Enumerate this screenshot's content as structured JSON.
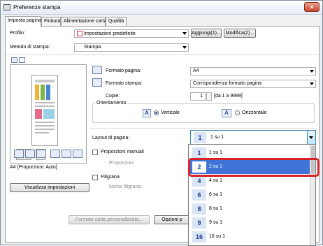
{
  "window": {
    "title": "Preferenze stampa",
    "close_label": "×"
  },
  "tabs": [
    "Imposta pagina",
    "Finitura",
    "Alimentazione carta",
    "Qualità"
  ],
  "profile": {
    "label": "Profilo:",
    "value": "Impostazioni predefinite",
    "add_btn": "Aggiungi(1)...",
    "edit_btn": "Modifica(2)..."
  },
  "print_method": {
    "label": "Metodo di stampa:",
    "value": "Stampa"
  },
  "preview": {
    "caption": "A4 [Proporzioni: Auto]",
    "view_settings_btn": "Visualizza impostazioni"
  },
  "page_settings": {
    "page_size_label": "Formato pagina:",
    "page_size_value": "A4",
    "output_size_label": "Formato stampa:",
    "output_size_value": "Corrispondenza formato pagina",
    "copies_label": "Copie:",
    "copies_value": "1",
    "copies_range": "[da 1 a 9999]"
  },
  "orientation": {
    "group_label": "Orientamento",
    "portrait": "Verticale",
    "landscape": "Orizzontale",
    "portrait_icon": "A",
    "landscape_icon": "A"
  },
  "layout": {
    "label": "Layout di pagina:",
    "value_num": "1",
    "value_text": "1 su 1"
  },
  "manual_scaling": {
    "label": "Proporzioni manuali",
    "scaling_label": "Proporzioni"
  },
  "watermark": {
    "label": "Filigrana",
    "name_label": "Nome filigrana:"
  },
  "bottom": {
    "custom_paper_btn": "Formato carta personalizzato...",
    "options_btn": "Opzioni p"
  },
  "layout_options": [
    {
      "num": "1",
      "text": "1 su 1"
    },
    {
      "num": "2",
      "text": "2 su 1"
    },
    {
      "num": "4",
      "text": "4 su 1"
    },
    {
      "num": "6",
      "text": "6 su 1"
    },
    {
      "num": "8",
      "text": "8 su 1"
    },
    {
      "num": "9",
      "text": "9 su 1"
    },
    {
      "num": "16",
      "text": "16 su 1"
    }
  ],
  "selected_layout_index": 1,
  "colors": {
    "selection": "#3f74d6",
    "highlight": "#d6242a"
  }
}
